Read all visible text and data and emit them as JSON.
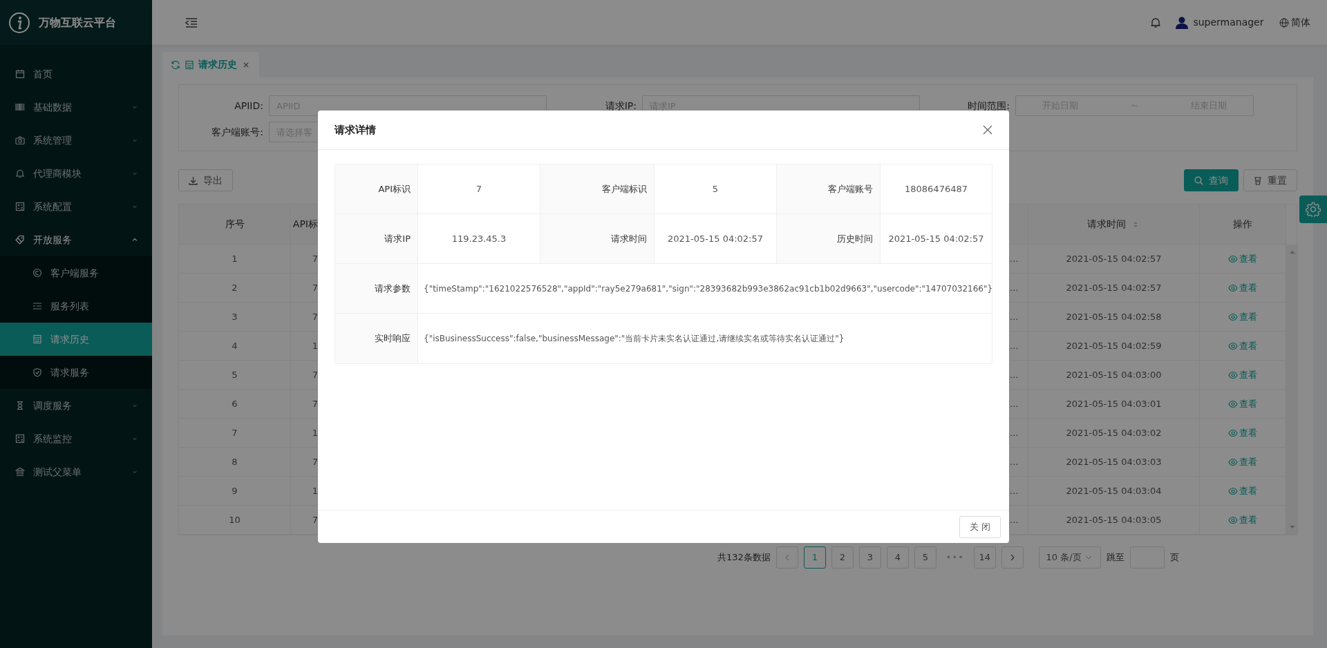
{
  "app": {
    "title": "万物互联云平台"
  },
  "sidebar": {
    "items": [
      {
        "label": "首页",
        "selected": false
      },
      {
        "label": "基础数据",
        "selected": false,
        "expanded": false
      },
      {
        "label": "系统管理",
        "selected": false,
        "expanded": false
      },
      {
        "label": "代理商模块",
        "selected": false,
        "expanded": false
      },
      {
        "label": "系统配置",
        "selected": false,
        "expanded": false
      },
      {
        "label": "开放服务",
        "selected": false,
        "expanded": true,
        "children": [
          {
            "label": "客户端服务",
            "selected": false
          },
          {
            "label": "服务列表",
            "selected": false
          },
          {
            "label": "请求历史",
            "selected": true
          },
          {
            "label": "请求服务",
            "selected": false
          }
        ]
      },
      {
        "label": "调度服务",
        "selected": false,
        "expanded": false
      },
      {
        "label": "系统监控",
        "selected": false,
        "expanded": false
      },
      {
        "label": "测试父菜单",
        "selected": false,
        "expanded": false
      }
    ]
  },
  "header": {
    "user": "supermanager",
    "language": "简体"
  },
  "tabs": [
    {
      "label": "请求历史",
      "selected": true
    }
  ],
  "filters": [
    {
      "kind": "text",
      "label": "APIID:",
      "placeholder": "APIID"
    },
    {
      "kind": "text",
      "label": "请求IP:",
      "placeholder": "请求IP"
    },
    {
      "kind": "range",
      "label": "时间范围:",
      "start_placeholder": "开始日期",
      "separator": "~",
      "end_placeholder": "结束日期"
    },
    {
      "kind": "text",
      "label": "客户端账号:",
      "placeholder": "请选择客"
    }
  ],
  "toolbar": {
    "export": "导出",
    "search": "查询",
    "reset": "重置"
  },
  "table": {
    "columns": [
      {
        "label": "序号"
      },
      {
        "label": "API标"
      },
      {
        "label": "请求时间",
        "sortable": true
      },
      {
        "label": "操作"
      }
    ],
    "rows": [
      {
        "index": "1",
        "column_2": "7",
        "column_5": "...",
        "time": "2021-05-15 04:02:57",
        "action": "查看"
      },
      {
        "index": "2",
        "column_2": "7",
        "column_5": "...",
        "time": "2021-05-15 04:02:57",
        "action": "查看"
      },
      {
        "index": "3",
        "column_2": "7",
        "column_5": "...",
        "time": "2021-05-15 04:02:58",
        "action": "查看"
      },
      {
        "index": "4",
        "column_2": "1",
        "column_5": "...",
        "time": "2021-05-15 04:02:59",
        "action": "查看"
      },
      {
        "index": "5",
        "column_2": "7",
        "column_5": "...",
        "time": "2021-05-15 04:03:00",
        "action": "查看"
      },
      {
        "index": "6",
        "column_2": "7",
        "column_5": "...",
        "time": "2021-05-15 04:03:01",
        "action": "查看"
      },
      {
        "index": "7",
        "column_2": "1",
        "column_5": "...",
        "time": "2021-05-15 04:03:02",
        "action": "查看"
      },
      {
        "index": "8",
        "column_2": "7",
        "column_5": "...",
        "time": "2021-05-15 04:03:03",
        "action": "查看"
      },
      {
        "index": "9",
        "column_2": "1",
        "column_5": "...",
        "time": "2021-05-15 04:03:04",
        "action": "查看"
      },
      {
        "index": "10",
        "column_2": "7",
        "column_5": "...",
        "time": "2021-05-15 04:03:05",
        "action": "查看"
      }
    ]
  },
  "pagination": {
    "total": "共132条数据",
    "pages": [
      {
        "label": "1",
        "selected": true
      },
      {
        "label": "2",
        "selected": false
      },
      {
        "label": "3",
        "selected": false
      },
      {
        "label": "4",
        "selected": false
      },
      {
        "label": "5",
        "selected": false
      },
      {
        "label": "•••",
        "kind": "ellipsis",
        "selected": false
      },
      {
        "label": "14",
        "selected": false
      }
    ],
    "page_size": "10 条/页",
    "jump_label": "跳至",
    "page_suffix": "页"
  },
  "dialog": {
    "title": "请求详情",
    "pairs": [
      {
        "label": "API标识",
        "value": "7"
      },
      {
        "label": "客户端标识",
        "value": "5"
      },
      {
        "label": "客户端账号",
        "value": "18086476487"
      },
      {
        "label": "请求IP",
        "value": "119.23.45.3"
      },
      {
        "label": "请求时间",
        "value": "2021-05-15 04:02:57"
      },
      {
        "label": "历史时间",
        "value": "2021-05-15 04:02:57"
      }
    ],
    "wide": [
      {
        "label": "请求参数",
        "value": "{\"timeStamp\":\"1621022576528\",\"appId\":\"ray5e279a681\",\"sign\":\"28393682b993e3862ac91cb1b02d9663\",\"usercode\":\"14707032166\"}"
      },
      {
        "label": "实时响应",
        "value": "{\"isBusinessSuccess\":false,\"businessMessage\":\"当前卡片未实名认证通过,请继续实名或等待实名认证通过\"}"
      }
    ],
    "close": "关 闭"
  }
}
